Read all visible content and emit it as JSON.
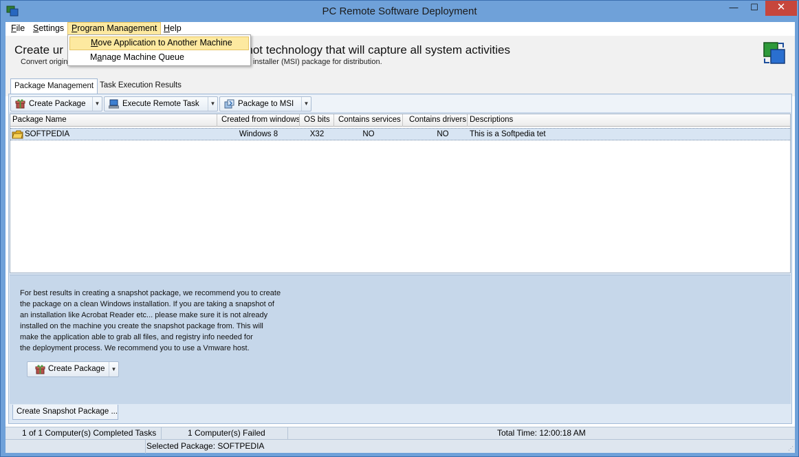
{
  "window": {
    "title": "PC Remote Software Deployment",
    "controls": {
      "minimize": "—",
      "maximize": "☐",
      "close": "✕"
    }
  },
  "menu": {
    "file": {
      "accel": "F",
      "rest": "ile"
    },
    "settings": {
      "accel": "S",
      "rest": "ettings"
    },
    "program_management": {
      "accel": "P",
      "rest": "rogram Management"
    },
    "help": {
      "accel": "H",
      "rest": "elp"
    }
  },
  "program_menu": {
    "item1": {
      "accel": "M",
      "rest": "ove Application to Another Machine"
    },
    "item2": {
      "pre": "M",
      "accel": "a",
      "rest": "nage Machine Queue"
    }
  },
  "header": {
    "title_left": "Create ur",
    "title_right": "shot technology that will capture all system activities",
    "subtitle_left": "Convert origin",
    "subtitle_right": "ws installer (MSI) package for distribution."
  },
  "tabs": {
    "package_management": "Package Management",
    "task_execution_results": "Task Execution Results"
  },
  "toolbar": {
    "create_package": "Create Package",
    "execute_remote_task": "Execute Remote Task",
    "package_to_msi": "Package to MSI",
    "dropdown_glyph": "▼"
  },
  "table": {
    "headers": [
      "Package Name",
      "Created from windows",
      "OS bits",
      "Contains services",
      "Contains drivers",
      "Descriptions"
    ],
    "rows": [
      [
        "SOFTPEDIA",
        "Windows 8",
        "X32",
        "NO",
        "NO",
        "This is a Softpedia tet"
      ]
    ]
  },
  "info": {
    "lines": [
      "For best results in creating a snapshot package, we recommend you to create",
      "the package on a clean Windows installation. If you are taking a snapshot of",
      "an installation like Acrobat Reader etc... please make sure it is not already",
      "installed on the machine you create the snapshot package from. This will",
      "make the application able to grab all files, and registry info needed for",
      "the deployment process. We recommend you to use a Vmware host."
    ],
    "create_package_button": "Create Package",
    "bottom_tab": "Create Snapshot Package ..."
  },
  "status": {
    "completed": "1 of 1 Computer(s) Completed Tasks",
    "failed": "1 Computer(s) Failed",
    "total_time": "Total Time: 12:00:18 AM",
    "selected_package": "Selected Package: SOFTPEDIA"
  },
  "colors": {
    "frame": "#6fa1d9",
    "menu_highlight": "#fde9a0",
    "close_button": "#c7463c",
    "selected_row": "#d8e5f3"
  }
}
